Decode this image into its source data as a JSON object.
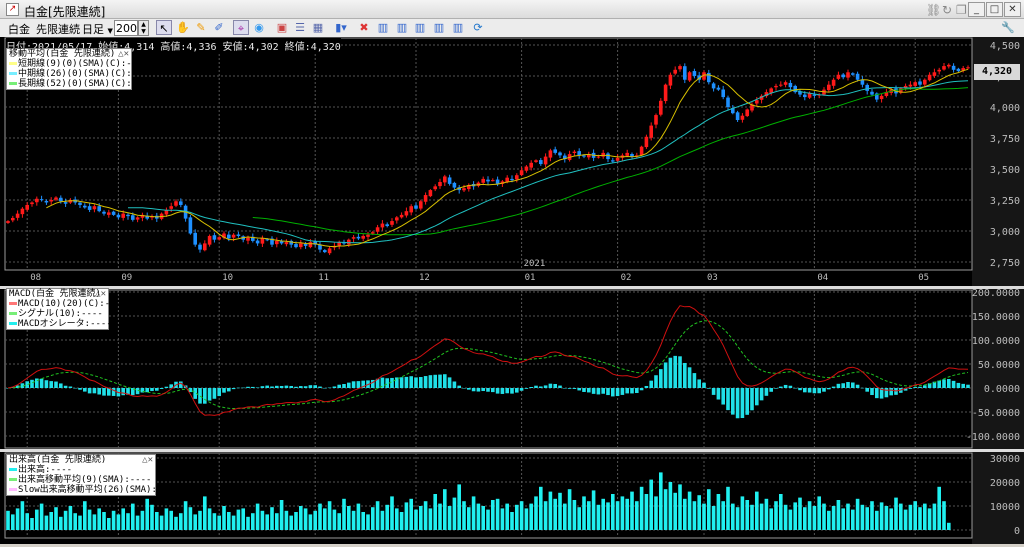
{
  "window": {
    "title": "白金[先限連続]",
    "icons": [
      "chart-app-icon",
      "link-icon",
      "refresh-icon",
      "restore-icon",
      "minimize-icon",
      "maximize-icon",
      "close-icon"
    ]
  },
  "toolbar": {
    "symbol": "白金",
    "contract": "先限連続",
    "period": "日足",
    "count": "200",
    "icons": [
      "select-arrow-icon",
      "hand-icon",
      "pencil-icon",
      "brush-icon",
      "crosshair-icon",
      "up-circle-icon",
      "chart-window-icon",
      "list-icon",
      "table-icon",
      "bar-chart-dropdown-icon",
      "delete-chart-icon",
      "indicator-1-icon",
      "indicator-2-icon",
      "indicator-3-icon",
      "indicator-4-icon",
      "indicator-5-icon",
      "reload-icon",
      "settings-wrench-icon"
    ]
  },
  "info": {
    "text": "日付:2021/05/17 始値:4,314 高値:4,336 安値:4,302 終値:4,320"
  },
  "current_price": "4,320",
  "colors": {
    "up": "#ff1a1a",
    "down": "#1e90ff",
    "ma_short": "#d8c000",
    "ma_mid": "#20c0c0",
    "ma_long": "#00b000",
    "macd": "#d01010",
    "signal": "#20c020",
    "osc": "#20e0e8",
    "volume": "#20f0f0"
  },
  "price_panel": {
    "legend_title": "移動平均(白金 先限連続)",
    "legend": [
      "短期線(9)(0)(SMA)(C):----",
      "中期線(26)(0)(SMA)(C):----",
      "長期線(52)(0)(SMA)(C):----"
    ],
    "axis_labels": [
      "4,500",
      "4,250",
      "4,000",
      "3,750",
      "3,500",
      "3,250",
      "3,000",
      "2,750"
    ],
    "axis_values": [
      4500,
      4250,
      4000,
      3750,
      3500,
      3250,
      3000,
      2750
    ],
    "months": [
      {
        "label": "08",
        "index": 4
      },
      {
        "label": "09",
        "index": 23
      },
      {
        "label": "10",
        "index": 44
      },
      {
        "label": "11",
        "index": 64
      },
      {
        "label": "12",
        "index": 85
      },
      {
        "label": "01",
        "index": 107
      },
      {
        "label": "02",
        "index": 127
      },
      {
        "label": "03",
        "index": 145
      },
      {
        "label": "04",
        "index": 168
      },
      {
        "label": "05",
        "index": 189
      }
    ],
    "year_label": "2021",
    "last_bar": {
      "open": 4314,
      "high": 4336,
      "low": 4302,
      "close": 4320
    }
  },
  "macd_panel": {
    "legend_title": "MACD(白金 先限連続)",
    "legend": [
      "MACD(10)(20)(C):----",
      "シグナル(10):----",
      "MACDオシレータ:----"
    ],
    "axis_labels": [
      "200.0000",
      "150.0000",
      "100.0000",
      "50.0000",
      "0.0000",
      "-50.0000",
      "-100.0000"
    ],
    "axis_values": [
      200000,
      150000,
      100000,
      50000,
      0,
      -50000,
      -100000
    ],
    "fast": 10,
    "slow": 20,
    "signal": 10,
    "value_multiplier": 1000
  },
  "volume_panel": {
    "legend_title": "出来高(白金 先限連続)",
    "legend": [
      "出来高:----",
      "出来高移動平均(9)(SMA):----",
      "Slow出来高移動平均(26)(SMA):----"
    ],
    "axis_labels": [
      "30000",
      "20000",
      "10000",
      "0"
    ],
    "axis_values": [
      30000,
      20000,
      10000,
      0
    ]
  },
  "chart_data": {
    "type": "candlestick",
    "ma_periods": [
      9,
      26,
      52
    ],
    "closes": [
      3080,
      3105,
      3140,
      3180,
      3210,
      3230,
      3260,
      3250,
      3230,
      3250,
      3270,
      3240,
      3220,
      3250,
      3230,
      3210,
      3190,
      3170,
      3200,
      3160,
      3140,
      3150,
      3130,
      3110,
      3140,
      3120,
      3090,
      3110,
      3130,
      3100,
      3120,
      3100,
      3140,
      3170,
      3200,
      3240,
      3210,
      3100,
      2980,
      2890,
      2850,
      2900,
      2960,
      2930,
      2950,
      2980,
      2940,
      2970,
      2960,
      2930,
      2945,
      2920,
      2900,
      2940,
      2930,
      2890,
      2920,
      2900,
      2910,
      2890,
      2870,
      2900,
      2880,
      2910,
      2890,
      2850,
      2830,
      2860,
      2880,
      2910,
      2900,
      2930,
      2950,
      2940,
      2960,
      2970,
      2990,
      3030,
      3060,
      3040,
      3080,
      3110,
      3130,
      3160,
      3200,
      3180,
      3240,
      3290,
      3330,
      3360,
      3395,
      3440,
      3380,
      3350,
      3330,
      3345,
      3370,
      3360,
      3390,
      3420,
      3400,
      3410,
      3380,
      3400,
      3430,
      3410,
      3450,
      3490,
      3520,
      3550,
      3570,
      3540,
      3600,
      3650,
      3630,
      3610,
      3580,
      3620,
      3640,
      3610,
      3600,
      3620,
      3590,
      3600,
      3630,
      3580,
      3560,
      3590,
      3610,
      3630,
      3600,
      3610,
      3680,
      3760,
      3850,
      3935,
      4050,
      4180,
      4260,
      4300,
      4330,
      4220,
      4280,
      4250,
      4220,
      4280,
      4200,
      4150,
      4140,
      4080,
      4000,
      3950,
      3895,
      3930,
      3980,
      4020,
      4055,
      4090,
      4120,
      4150,
      4170,
      4180,
      4200,
      4160,
      4120,
      4100,
      4080,
      4110,
      4090,
      4100,
      4140,
      4180,
      4220,
      4260,
      4240,
      4280,
      4260,
      4220,
      4180,
      4130,
      4100,
      4060,
      4090,
      4120,
      4140,
      4110,
      4150,
      4170,
      4180,
      4200,
      4180,
      4220,
      4260,
      4280,
      4300,
      4330,
      4340,
      4300,
      4290,
      4314,
      4320
    ],
    "volumes": [
      8000,
      6500,
      9000,
      12000,
      7000,
      5000,
      8500,
      11000,
      6000,
      7500,
      9500,
      5500,
      8000,
      10000,
      7000,
      6000,
      12000,
      8500,
      6500,
      9000,
      7500,
      5000,
      8000,
      6500,
      9000,
      7000,
      11000,
      6000,
      8000,
      13000,
      10500,
      7500,
      6000,
      9000,
      8000,
      5500,
      7000,
      12000,
      9500,
      6500,
      8000,
      14000,
      9000,
      7000,
      6000,
      10000,
      7500,
      6000,
      8500,
      9000,
      5500,
      7000,
      11000,
      8000,
      6500,
      9500,
      7000,
      12500,
      8000,
      6000,
      7500,
      10000,
      9000,
      6500,
      8000,
      11000,
      9000,
      12000,
      8500,
      7000,
      13000,
      10000,
      8000,
      11000,
      7500,
      6500,
      9500,
      12000,
      8000,
      10500,
      14000,
      9000,
      7500,
      11500,
      13000,
      8500,
      10000,
      12000,
      9000,
      15000,
      11000,
      17000,
      10000,
      13500,
      19000,
      12000,
      9500,
      14000,
      11000,
      10000,
      8500,
      12500,
      13000,
      9000,
      11000,
      7500,
      10500,
      12000,
      9000,
      11000,
      14000,
      18000,
      12000,
      16000,
      13000,
      15500,
      11000,
      17000,
      12500,
      9500,
      14000,
      12000,
      16500,
      10500,
      13000,
      11500,
      15000,
      12000,
      14000,
      13000,
      16000,
      12000,
      18000,
      15000,
      21000,
      14000,
      24000,
      17000,
      20000,
      15500,
      19000,
      13000,
      16000,
      12000,
      14500,
      11000,
      17000,
      10000,
      15000,
      12000,
      18000,
      11000,
      9500,
      14000,
      12500,
      10500,
      16000,
      11000,
      13000,
      9000,
      12000,
      15000,
      10500,
      8500,
      11500,
      13500,
      9500,
      12000,
      10000,
      14000,
      11000,
      8000,
      10000,
      12500,
      9000,
      11000,
      8500,
      13000,
      10500,
      9500,
      12000,
      8000,
      11500,
      10000,
      9000,
      13500,
      11000,
      8500,
      10500,
      12000,
      9500,
      11000,
      9000,
      11000,
      18000,
      12000,
      3000
    ]
  }
}
